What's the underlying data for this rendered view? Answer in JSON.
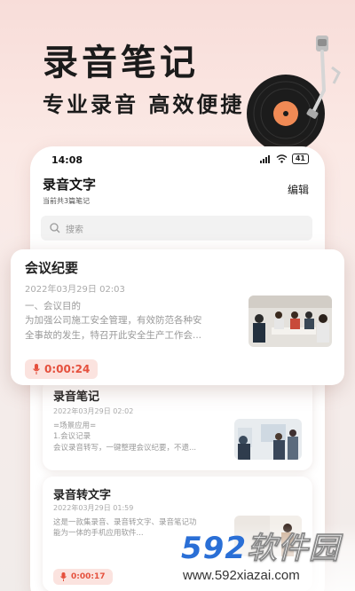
{
  "hero": {
    "title": "录音笔记",
    "subtitle": "专业录音 高效便捷"
  },
  "status_bar": {
    "time": "14:08",
    "battery": "41"
  },
  "header": {
    "title": "录音文字",
    "edit_label": "编辑",
    "note_count": "当前共3篇笔记"
  },
  "search": {
    "placeholder": "搜索"
  },
  "notes": [
    {
      "title": "会议纪要",
      "date": "2022年03月29日 02:03",
      "body": [
        "一、会议目的",
        "为加强公司施工安全管理，有效防范各种安",
        "全事故的发生，特召开此安全生产工作会..."
      ],
      "duration": "0:00:24"
    },
    {
      "title": "录音笔记",
      "date": "2022年03月29日 02:02",
      "body": [
        "=场景应用=",
        "1.会议记录",
        "会议录音转写，一键整理会议纪要，不遗..."
      ]
    },
    {
      "title": "录音转文字",
      "date": "2022年03月29日 01:59",
      "body": [
        "这是一款集录音、录音转文字、录音笔记功",
        "能为一体的手机应用软件..."
      ],
      "duration": "0:00:17"
    }
  ],
  "watermark": {
    "logo_num": "592",
    "logo_text": "软件园",
    "url": "www.592xiazai.com"
  },
  "colors": {
    "accent": "#e5503d",
    "duration_bg": "#fbe3df",
    "brand_blue": "#2a6fd6"
  }
}
